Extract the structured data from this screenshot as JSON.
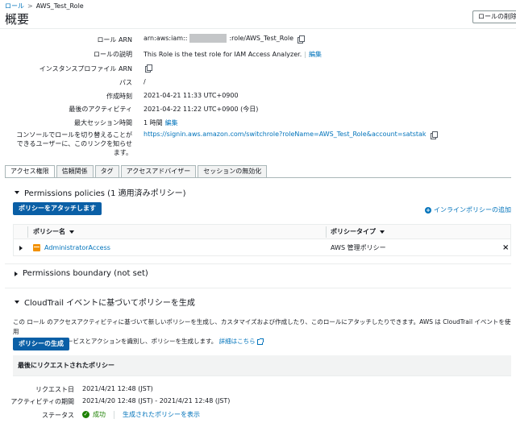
{
  "breadcrumb": {
    "root": "ロール",
    "separator": ">",
    "current": "AWS_Test_Role"
  },
  "page_title": "概要",
  "delete_button": "ロールの削除",
  "summary": {
    "arn_label": "ロール ARN",
    "arn_prefix": "arn:aws:iam::",
    "arn_suffix": ":role/AWS_Test_Role",
    "desc_label": "ロールの説明",
    "desc_value": "This Role is the test role for IAM Access Analyzer.",
    "desc_edit": "編集",
    "instance_profile_label": "インスタンスプロファイル ARN",
    "path_label": "パス",
    "path_value": "/",
    "created_label": "作成時刻",
    "created_value": "2021-04-21 11:33 UTC+0900",
    "last_activity_label": "最後のアクティビティ",
    "last_activity_value": "2021-04-22 11:22 UTC+0900 (今日)",
    "max_session_label": "最大セッション時間",
    "max_session_value": "1 時間",
    "max_session_edit": "編集",
    "switch_label_1": "コンソールでロールを切り替えることが",
    "switch_label_2": "できるユーザーに、このリンクを知らせ",
    "switch_label_3": "ます。",
    "switch_link": "https://signin.aws.amazon.com/switchrole?roleName=AWS_Test_Role&account=satstak"
  },
  "tabs": [
    "アクセス権限",
    "信頼関係",
    "タグ",
    "アクセスアドバイザー",
    "セッションの無効化"
  ],
  "permissions": {
    "heading": "Permissions policies (1 適用済みポリシー)",
    "attach_button": "ポリシーをアタッチします",
    "add_inline": "インラインポリシーの追加",
    "col_name": "ポリシー名",
    "col_type": "ポリシータイプ",
    "rows": [
      {
        "name": "AdministratorAccess",
        "type": "AWS 管理ポリシー"
      }
    ]
  },
  "boundary_heading": "Permissions boundary (not set)",
  "cloudtrail": {
    "heading": "CloudTrail イベントに基づいてポリシーを生成",
    "desc_1": "この ロール のアクセスアクティビティに基づいて新しいポリシーを生成し、カスタマイズおよび作成したり、このロールにアタッチしたりできます。AWS は CloudTrail イベントを使用",
    "desc_2": "して、使用されるサービスとアクションを識別し、ポリシーを生成します。",
    "details_link": "詳細はこちら",
    "generate_button": "ポリシーの生成",
    "last_request_heading": "最後にリクエストされたポリシー",
    "request_label": "リクエスト日",
    "request_value": "2021/4/21 12:48 (JST)",
    "period_label": "アクティビティの期間",
    "period_value": "2021/4/20 12:48 (JST) - 2021/4/21 12:48 (JST)",
    "status_label": "ステータス",
    "status_value": "成功",
    "view_link": "生成されたポリシーを表示"
  }
}
